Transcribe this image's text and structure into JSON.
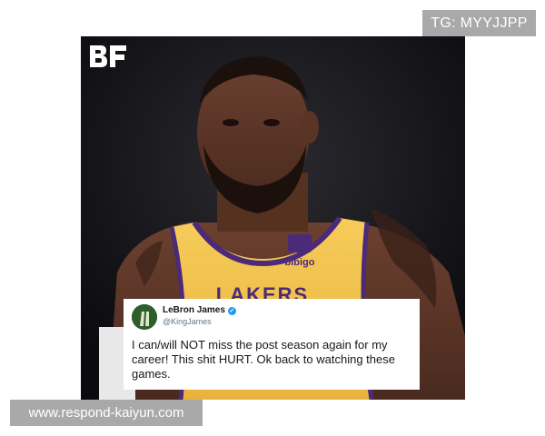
{
  "watermark_top": "TG: MYYJJPP",
  "watermark_bottom": "www.respond-kaiyun.com",
  "logo": "BF",
  "jersey_sponsor": "bibigo",
  "jersey_lettering": "LAKERS",
  "tweet": {
    "name": "LeBron James",
    "handle": "@KingJames",
    "verified_icon": "verified-badge-icon",
    "text": "I can/will NOT miss the post season again for my career! This shit HURT. Ok back to watching these games."
  },
  "colors": {
    "jersey_gold": "#f2c04a",
    "jersey_purple": "#4b2a7a",
    "background_dark": "#0f0f12",
    "verified_blue": "#1d9bf0"
  }
}
